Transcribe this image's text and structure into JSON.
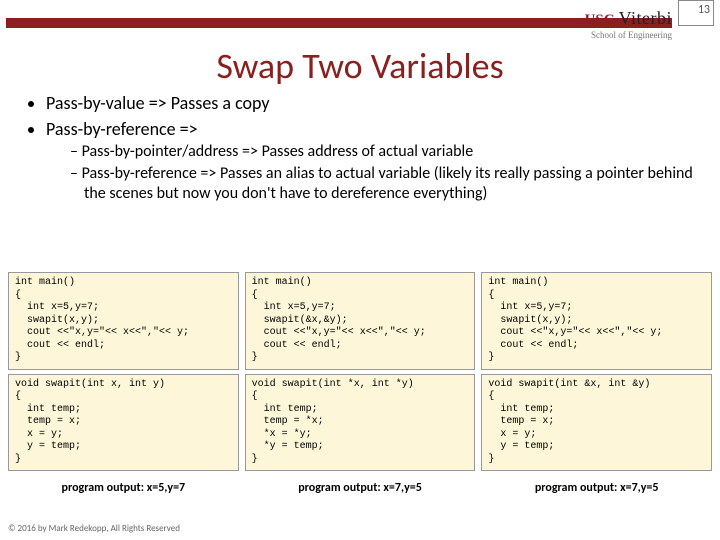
{
  "page_number": "13",
  "logo": {
    "usc": "USC",
    "viterbi": "Viterbi",
    "sub": "School of Engineering"
  },
  "title": "Swap Two Variables",
  "bullets": {
    "b1": "Pass-by-value => Passes a copy",
    "b2": "Pass-by-reference =>",
    "sub1": "Pass-by-pointer/address => Passes address of actual variable",
    "sub2": "Pass-by-reference => Passes an alias to actual variable (likely its really passing a pointer behind the scenes but now you don't have to dereference everything)"
  },
  "code": {
    "col1_main": "int main()\n{\n  int x=5,y=7;\n  swapit(x,y);\n  cout <<\"x,y=\"<< x<<\",\"<< y;\n  cout << endl;\n}",
    "col1_func": "void swapit(int x, int y)\n{\n  int temp;\n  temp = x;\n  x = y;\n  y = temp;\n}",
    "col1_out": "program output:  x=5,y=7",
    "col2_main": "int main()\n{\n  int x=5,y=7;\n  swapit(&x,&y);\n  cout <<\"x,y=\"<< x<<\",\"<< y;\n  cout << endl;\n}",
    "col2_func": "void swapit(int *x, int *y)\n{\n  int temp;\n  temp = *x;\n  *x = *y;\n  *y = temp;\n}",
    "col2_out": "program output:  x=7,y=5",
    "col3_main": "int main()\n{\n  int x=5,y=7;\n  swapit(x,y);\n  cout <<\"x,y=\"<< x<<\",\"<< y;\n  cout << endl;\n}",
    "col3_func": "void swapit(int &x, int &y)\n{\n  int temp;\n  temp = x;\n  x = y;\n  y = temp;\n}",
    "col3_out": "program output:  x=7,y=5"
  },
  "footer": "© 2016 by Mark Redekopp, All Rights Reserved"
}
